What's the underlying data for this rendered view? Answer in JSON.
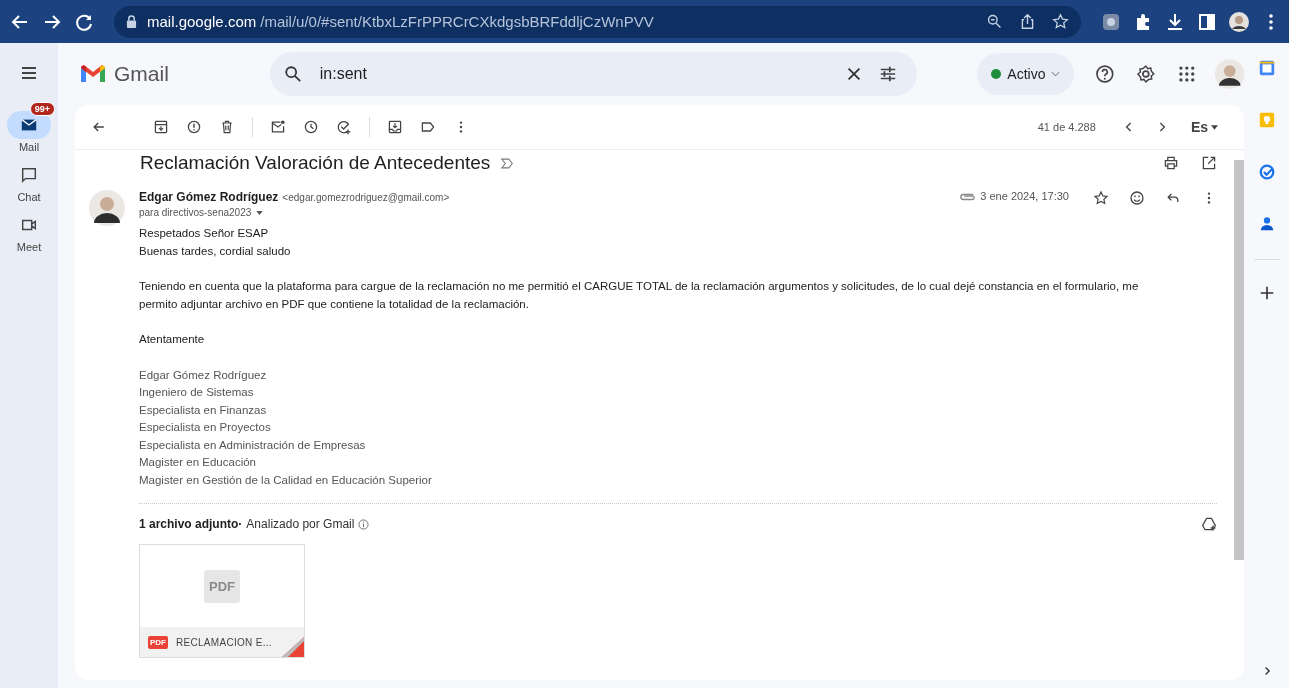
{
  "browser": {
    "url_host": "mail.google.com",
    "url_path": "/mail/u/0/#sent/KtbxLzFrPPRCrCXkdgsbBRFddljCzWnPVV"
  },
  "header": {
    "logo": "Gmail",
    "search": {
      "value": "in:sent"
    },
    "status": {
      "label": "Activo",
      "color": "#1e8e3e"
    }
  },
  "rail": [
    {
      "label": "Mail",
      "selected": true,
      "badge": "99+",
      "kind": "mail"
    },
    {
      "label": "Chat",
      "selected": false,
      "kind": "chat"
    },
    {
      "label": "Meet",
      "selected": false,
      "kind": "meet"
    }
  ],
  "toolbar": {
    "counter": "41 de 4.288",
    "input_tool": "Es"
  },
  "message": {
    "subject": "Reclamación Valoración de Antecedentes",
    "sender_name": "Edgar Gómez Rodríguez",
    "sender_email": "<edgar.gomezrodriguez@gmail.com>",
    "recipients": "para directivos-sena2023",
    "date": "3 ene 2024, 17:30",
    "paragraphs": [
      {
        "kind": "text",
        "lines": [
          "Respetados Señor ESAP",
          "Buenas tardes, cordial saludo"
        ]
      },
      {
        "kind": "text",
        "lines": [
          "Teniendo en cuenta que la plataforma para cargue de la reclamación no me permitió el CARGUE TOTAL de la reclamación argumentos y solicitudes, de lo cual dejé constancia en el formulario, me permito adjuntar archivo en PDF que contiene la totalidad de la reclamación."
        ]
      },
      {
        "kind": "text",
        "lines": [
          "Atentamente"
        ]
      },
      {
        "kind": "signature",
        "lines": [
          "Edgar Gómez Rodríguez",
          "Ingeniero de Sistemas",
          "Especialista en Finanzas",
          "Especialista en Proyectos",
          "Especialista en Administración de Empresas",
          "Magister en Educación",
          "Magister en Gestión de la Calidad en Educación Superior"
        ]
      }
    ]
  },
  "attachments": {
    "summary": "1 archivo adjunto·",
    "scan_note": "Analizado por Gmail",
    "items": [
      {
        "thumb_label": "PDF",
        "type_label": "PDF",
        "name": "RECLAMACION E..."
      }
    ]
  }
}
